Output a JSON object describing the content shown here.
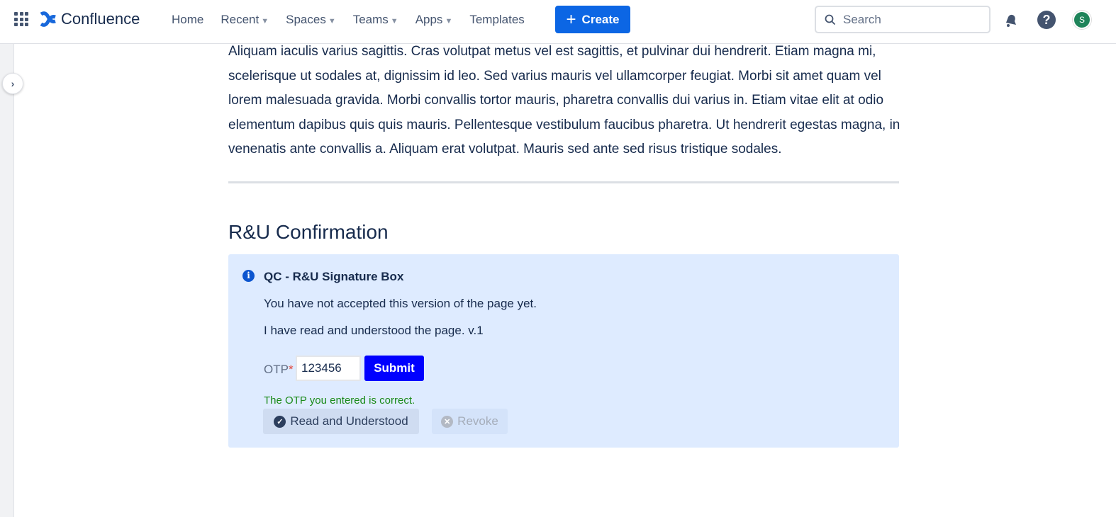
{
  "header": {
    "app_name": "Confluence",
    "nav": [
      {
        "label": "Home"
      },
      {
        "label": "Recent"
      },
      {
        "label": "Spaces"
      },
      {
        "label": "Teams"
      },
      {
        "label": "Apps"
      },
      {
        "label": "Templates"
      }
    ],
    "create_label": "Create",
    "search_placeholder": "Search",
    "avatar_initial": "S"
  },
  "content": {
    "paragraph": "Aliquam iaculis varius sagittis. Cras volutpat metus vel est sagittis, et pulvinar dui hendrerit. Etiam magna mi, scelerisque ut sodales at, dignissim id leo. Sed varius mauris vel ullamcorper feugiat. Morbi sit amet quam vel lorem malesuada gravida. Morbi convallis tortor mauris, pharetra convallis dui varius in. Etiam vitae elit at odio elementum dapibus quis quis mauris. Pellentesque vestibulum faucibus pharetra. Ut hendrerit egestas magna, in venenatis ante convallis a. Aliquam erat volutpat. Mauris sed ante sed risus tristique sodales.",
    "heading": "R&U Confirmation"
  },
  "panel": {
    "title": "QC - R&U Signature Box",
    "status": "You have not accepted this version of the page yet.",
    "statement": "I have read and understood the page. v.1",
    "otp_label": "OTP",
    "required_mark": "*",
    "otp_value": "123456",
    "submit_label": "Submit",
    "otp_message": "The OTP you entered is correct.",
    "read_label": "Read and Understood",
    "revoke_label": "Revoke"
  }
}
